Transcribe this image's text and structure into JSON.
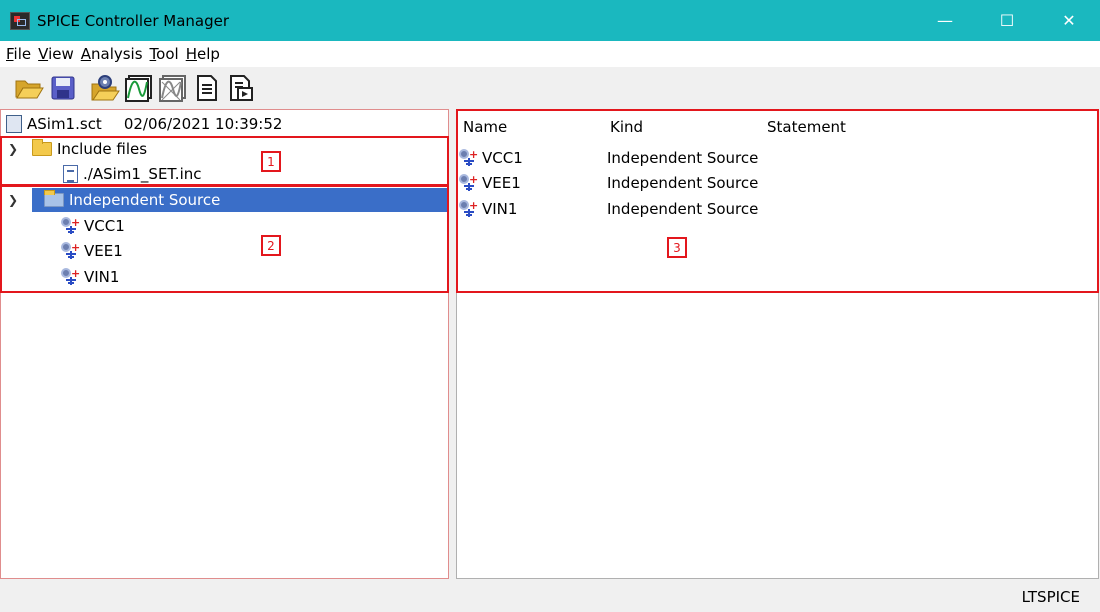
{
  "window": {
    "title": "SPICE Controller Manager",
    "minimize": "—",
    "maximize": "☐",
    "close": "✕"
  },
  "menu": [
    {
      "mnemonic": "F",
      "rest": "ile"
    },
    {
      "mnemonic": "V",
      "rest": "iew"
    },
    {
      "mnemonic": "A",
      "rest": "nalysis"
    },
    {
      "mnemonic": "T",
      "rest": "ool"
    },
    {
      "mnemonic": "H",
      "rest": "elp"
    }
  ],
  "toolbar": {
    "icons": [
      "open-folder-icon",
      "save-icon",
      "simulation-settings-icon",
      "waveform-icon",
      "waveform-disabled-icon",
      "document-icon",
      "run-document-icon"
    ]
  },
  "tree": {
    "root": {
      "file": "ASim1.sct",
      "timestamp": "02/06/2021 10:39:52"
    },
    "groups": [
      {
        "label": "Include files",
        "children": [
          "./ASim1_SET.inc"
        ]
      },
      {
        "label": "Independent Source",
        "children": [
          "VCC1",
          "VEE1",
          "VIN1"
        ]
      }
    ]
  },
  "list": {
    "columns": [
      "Name",
      "Kind",
      "Statement"
    ],
    "rows": [
      {
        "name": "VCC1",
        "kind": "Independent Source",
        "statement": ""
      },
      {
        "name": "VEE1",
        "kind": "Independent Source",
        "statement": ""
      },
      {
        "name": "VIN1",
        "kind": "Independent Source",
        "statement": ""
      }
    ]
  },
  "annotations": [
    "1",
    "2",
    "3"
  ],
  "status": {
    "simulator": "LTSPICE"
  },
  "colors": {
    "titlebar": "#1ab8bf",
    "selection": "#3a6ec8",
    "annotation": "#e3171d"
  }
}
